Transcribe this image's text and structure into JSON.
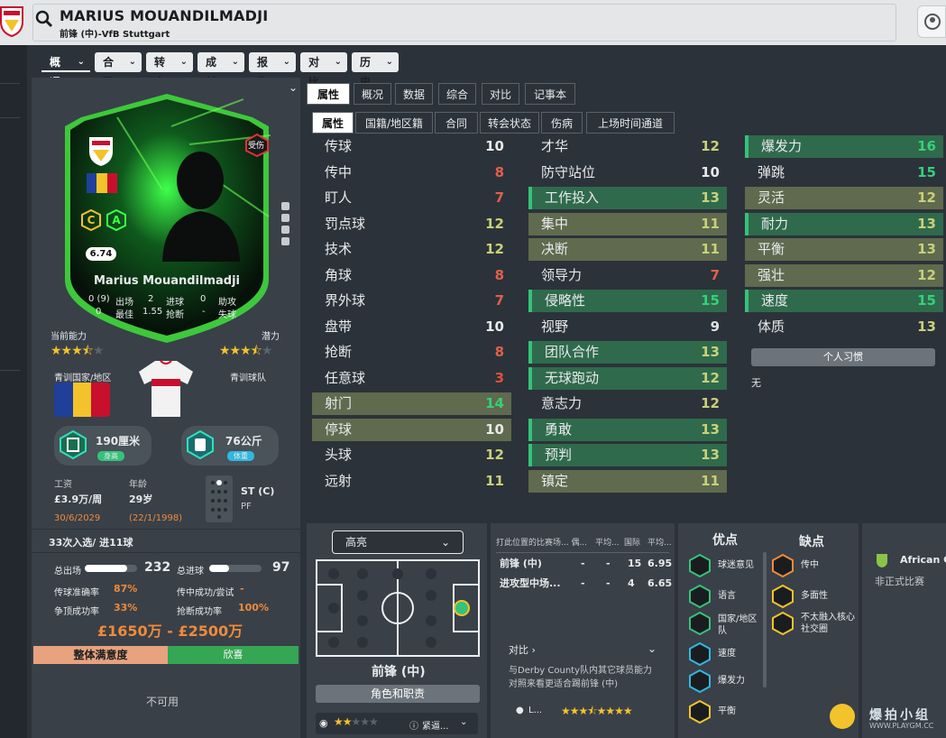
{
  "header": {
    "name": "MARIUS MOUANDILMADJI",
    "subtitle": "前锋 (中)-VfB Stuttgart"
  },
  "nav": [
    {
      "label": "概况",
      "active": true
    },
    {
      "label": "合同"
    },
    {
      "label": "转会"
    },
    {
      "label": "成长"
    },
    {
      "label": "报告"
    },
    {
      "label": "对比"
    },
    {
      "label": "历史"
    }
  ],
  "card": {
    "name": "Marius Mouandilmadji",
    "rating": "6.74",
    "injury": "受伤",
    "stats": [
      [
        "0 (9)",
        "出场",
        "2",
        "进球",
        "0",
        "助攻"
      ],
      [
        "0",
        "最佳",
        "1.55",
        "抢断",
        "-",
        "失球"
      ]
    ],
    "badges": [
      "C",
      "A"
    ]
  },
  "left": {
    "current_ability_label": "当前能力",
    "potential_label": "潜力",
    "current_stars": 3.5,
    "potential_stars": 3.5,
    "youth_nation_label": "青训国家/地区",
    "youth_club_label": "青训球队",
    "height": "190厘米",
    "height_tag": "身高",
    "weight": "76公斤",
    "weight_tag": "体重",
    "wage_label": "工资",
    "wage": "£3.9万/周",
    "age_label": "年龄",
    "age": "29岁",
    "contract_end": "30/6/2029",
    "dob": "(22/1/1998)",
    "position_main": "ST (C)",
    "position_sub": "PF",
    "caps": "33次入选/ 进11球",
    "apps_label": "总出场",
    "apps": "232",
    "goals_label": "总进球",
    "goals": "97",
    "pass_label": "传球准确率",
    "pass": "87%",
    "cross_label": "传中成功/尝试",
    "cross": "-",
    "header_label": "争顶成功率",
    "header_val": "33%",
    "tackle_label": "抢断成功率",
    "tackle": "100%",
    "value": "£1650万 - £2500万",
    "satisfaction_label": "整体满意度",
    "satisfaction_val": "欣喜",
    "unavailable": "不可用"
  },
  "tabs_top": [
    "属性",
    "概况",
    "数据",
    "综合",
    "对比",
    "记事本"
  ],
  "tabs_sub": [
    "属性",
    "国籍/地区籍",
    "合同",
    "转会状态",
    "伤病",
    "上场时间通道"
  ],
  "technical": [
    [
      "传球",
      "10",
      ""
    ],
    [
      "传中",
      "8",
      ""
    ],
    [
      "盯人",
      "7",
      ""
    ],
    [
      "罚点球",
      "12",
      ""
    ],
    [
      "技术",
      "12",
      ""
    ],
    [
      "角球",
      "8",
      ""
    ],
    [
      "界外球",
      "7",
      ""
    ],
    [
      "盘带",
      "10",
      ""
    ],
    [
      "抢断",
      "8",
      ""
    ],
    [
      "任意球",
      "3",
      ""
    ],
    [
      "射门",
      "14",
      "olive"
    ],
    [
      "停球",
      "10",
      "olive"
    ],
    [
      "头球",
      "12",
      ""
    ],
    [
      "远射",
      "11",
      ""
    ]
  ],
  "mental": [
    [
      "才华",
      "12",
      ""
    ],
    [
      "防守站位",
      "10",
      ""
    ],
    [
      "工作投入",
      "13",
      "green"
    ],
    [
      "集中",
      "11",
      "olive"
    ],
    [
      "决断",
      "11",
      "olive"
    ],
    [
      "领导力",
      "7",
      ""
    ],
    [
      "侵略性",
      "15",
      "green"
    ],
    [
      "视野",
      "9",
      ""
    ],
    [
      "团队合作",
      "13",
      "green"
    ],
    [
      "无球跑动",
      "12",
      "green"
    ],
    [
      "意志力",
      "12",
      ""
    ],
    [
      "勇敢",
      "13",
      "green"
    ],
    [
      "预判",
      "13",
      "green"
    ],
    [
      "镇定",
      "11",
      "olive"
    ]
  ],
  "physical": [
    [
      "爆发力",
      "16",
      "green"
    ],
    [
      "弹跳",
      "15",
      ""
    ],
    [
      "灵活",
      "12",
      "olive"
    ],
    [
      "耐力",
      "13",
      "green"
    ],
    [
      "平衡",
      "13",
      "olive"
    ],
    [
      "强壮",
      "12",
      "olive"
    ],
    [
      "速度",
      "15",
      "green"
    ],
    [
      "体质",
      "13",
      ""
    ]
  ],
  "traits": {
    "button": "个人习惯",
    "value": "无"
  },
  "bottom": {
    "dropdown": "高亮",
    "pos_label": "前锋 (中)",
    "role_btn": "角色和职责",
    "table_head": [
      "打此位置的比赛场... 偶...",
      "平均...",
      "国际",
      "平均..."
    ],
    "table_rows": [
      [
        "前锋 (中)",
        "-",
        "-",
        "15",
        "6.95"
      ],
      [
        "进攻型中场...",
        "-",
        "-",
        "4",
        "6.65"
      ]
    ],
    "compare_label": "对比",
    "compare_text": "与Derby County队内其它球员能力对照来看更适合踢前锋 (中)",
    "compare_player": "L...",
    "strengths_label": "优点",
    "weaknesses_label": "缺点",
    "strengths": [
      "球迷意见",
      "语言",
      "国家/地区队",
      "速度",
      "爆发力",
      "平衡"
    ],
    "weaknesses": [
      "传中",
      "多面性",
      "不太融入核心社交圈"
    ],
    "league": "African C",
    "league_sub": "非正式比赛",
    "role_short": "紧逼..."
  },
  "watermark": "爆拍小组",
  "watermark_url": "WWW.PLAYGM.CC",
  "colors": {
    "green": "#35c27a",
    "accent": "#f08a3a",
    "teal": "#2fe0c0"
  }
}
